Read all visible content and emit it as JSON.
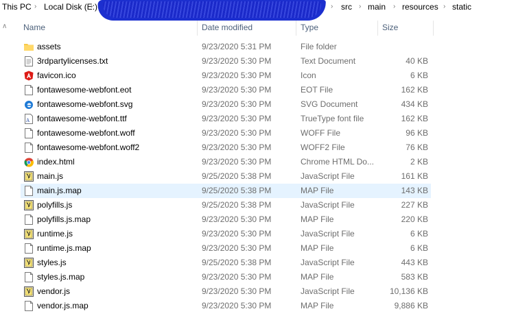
{
  "breadcrumb": {
    "items": [
      "This PC",
      "Local Disk (E:)",
      "src",
      "main",
      "resources",
      "static"
    ]
  },
  "columns": {
    "name": "Name",
    "date": "Date modified",
    "type": "Type",
    "size": "Size"
  },
  "files": [
    {
      "name": "assets",
      "date": "9/23/2020 5:31 PM",
      "type": "File folder",
      "size": "",
      "icon": "folder-icon"
    },
    {
      "name": "3rdpartylicenses.txt",
      "date": "9/23/2020 5:30 PM",
      "type": "Text Document",
      "size": "40 KB",
      "icon": "text-file-icon"
    },
    {
      "name": "favicon.ico",
      "date": "9/23/2020 5:30 PM",
      "type": "Icon",
      "size": "6 KB",
      "icon": "angular-icon"
    },
    {
      "name": "fontawesome-webfont.eot",
      "date": "9/23/2020 5:30 PM",
      "type": "EOT File",
      "size": "162 KB",
      "icon": "blank-file-icon"
    },
    {
      "name": "fontawesome-webfont.svg",
      "date": "9/23/2020 5:30 PM",
      "type": "SVG Document",
      "size": "434 KB",
      "icon": "edge-icon"
    },
    {
      "name": "fontawesome-webfont.ttf",
      "date": "9/23/2020 5:30 PM",
      "type": "TrueType font file",
      "size": "162 KB",
      "icon": "font-file-icon"
    },
    {
      "name": "fontawesome-webfont.woff",
      "date": "9/23/2020 5:30 PM",
      "type": "WOFF File",
      "size": "96 KB",
      "icon": "blank-file-icon"
    },
    {
      "name": "fontawesome-webfont.woff2",
      "date": "9/23/2020 5:30 PM",
      "type": "WOFF2 File",
      "size": "76 KB",
      "icon": "blank-file-icon"
    },
    {
      "name": "index.html",
      "date": "9/23/2020 5:30 PM",
      "type": "Chrome HTML Do...",
      "size": "2 KB",
      "icon": "chrome-icon"
    },
    {
      "name": "main.js",
      "date": "9/25/2020 5:38 PM",
      "type": "JavaScript File",
      "size": "161 KB",
      "icon": "js-file-icon"
    },
    {
      "name": "main.js.map",
      "date": "9/25/2020 5:38 PM",
      "type": "MAP File",
      "size": "143 KB",
      "icon": "blank-file-icon",
      "hover": true
    },
    {
      "name": "polyfills.js",
      "date": "9/25/2020 5:38 PM",
      "type": "JavaScript File",
      "size": "227 KB",
      "icon": "js-file-icon"
    },
    {
      "name": "polyfills.js.map",
      "date": "9/23/2020 5:30 PM",
      "type": "MAP File",
      "size": "220 KB",
      "icon": "blank-file-icon"
    },
    {
      "name": "runtime.js",
      "date": "9/23/2020 5:30 PM",
      "type": "JavaScript File",
      "size": "6 KB",
      "icon": "js-file-icon"
    },
    {
      "name": "runtime.js.map",
      "date": "9/23/2020 5:30 PM",
      "type": "MAP File",
      "size": "6 KB",
      "icon": "blank-file-icon"
    },
    {
      "name": "styles.js",
      "date": "9/25/2020 5:38 PM",
      "type": "JavaScript File",
      "size": "443 KB",
      "icon": "js-file-icon"
    },
    {
      "name": "styles.js.map",
      "date": "9/23/2020 5:30 PM",
      "type": "MAP File",
      "size": "583 KB",
      "icon": "blank-file-icon"
    },
    {
      "name": "vendor.js",
      "date": "9/23/2020 5:30 PM",
      "type": "JavaScript File",
      "size": "10,136 KB",
      "icon": "js-file-icon"
    },
    {
      "name": "vendor.js.map",
      "date": "9/23/2020 5:30 PM",
      "type": "MAP File",
      "size": "9,886 KB",
      "icon": "blank-file-icon"
    }
  ]
}
